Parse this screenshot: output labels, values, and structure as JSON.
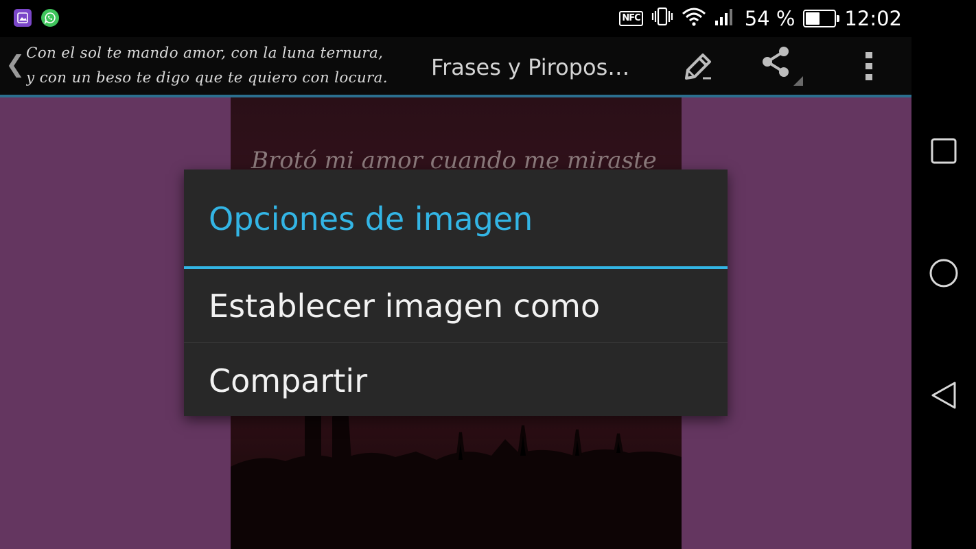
{
  "status_bar": {
    "notifications": [
      "gallery-icon",
      "whatsapp-icon"
    ],
    "icons": [
      "nfc-icon",
      "vibrate-icon",
      "wifi-icon",
      "signal-icon"
    ],
    "nfc_label": "NFC",
    "battery_percent_text": "54 %",
    "battery_level": 0.54,
    "time": "12:02"
  },
  "action_bar": {
    "ticker_line1": "Con el sol te mando amor, con la luna ternura,",
    "ticker_line2": "y con un beso te digo que te quiero con locura.",
    "title": "Frases y Piropos…",
    "actions": [
      "edit-icon",
      "share-icon",
      "overflow-menu-icon"
    ],
    "accent_color": "#33b5e5"
  },
  "content": {
    "background_color": "#643660",
    "photo_text": "Brotó mi amor cuando me miraste"
  },
  "dialog": {
    "title": "Opciones de imagen",
    "title_color": "#33b5e5",
    "items": [
      {
        "label": "Establecer imagen como"
      },
      {
        "label": "Compartir"
      }
    ]
  },
  "nav_bar": {
    "buttons": [
      "recent-apps-icon",
      "home-icon",
      "back-icon"
    ]
  }
}
